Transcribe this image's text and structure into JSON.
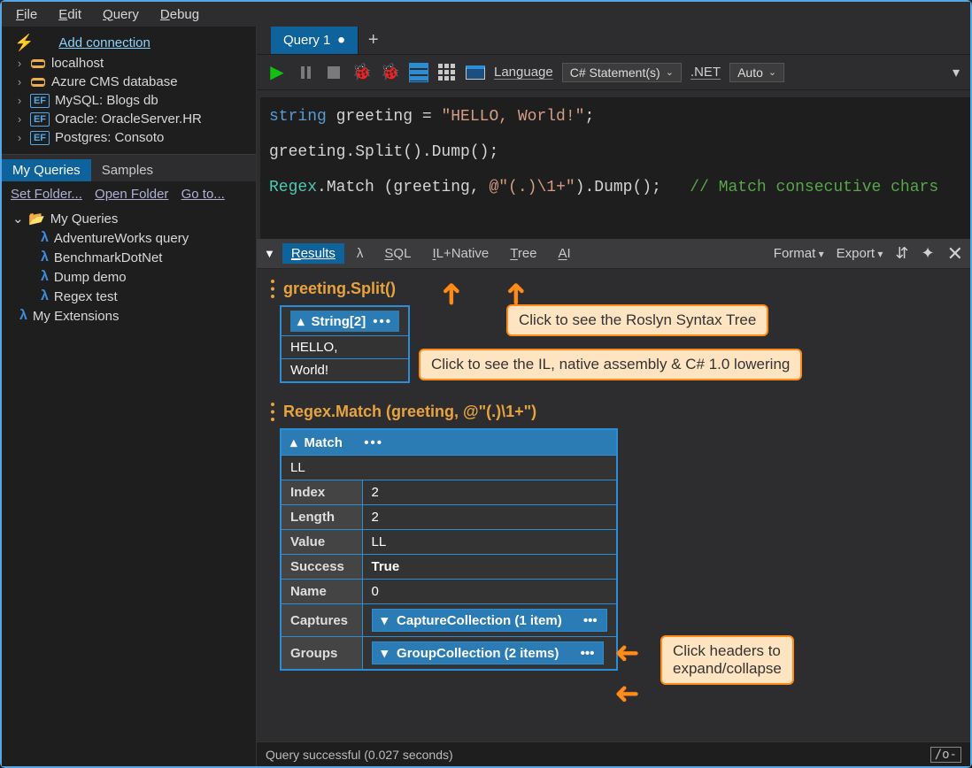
{
  "menu": [
    "File",
    "Edit",
    "Query",
    "Debug"
  ],
  "sidebar": {
    "add_connection": "Add connection",
    "connections": [
      {
        "icon": "db",
        "label": "localhost"
      },
      {
        "icon": "db",
        "label": "Azure CMS database"
      },
      {
        "icon": "ef",
        "label": "MySQL: Blogs db"
      },
      {
        "icon": "ef",
        "label": "Oracle: OracleServer.HR"
      },
      {
        "icon": "ef",
        "label": "Postgres: Consoto"
      }
    ],
    "queries_tabs": {
      "active": "My Queries",
      "inactive": "Samples"
    },
    "links": {
      "set": "Set Folder...",
      "open": "Open Folder",
      "goto": "Go to..."
    },
    "root": "My Queries",
    "items": [
      "AdventureWorks query",
      "BenchmarkDotNet",
      "Dump demo",
      "Regex test"
    ],
    "ext": "My Extensions"
  },
  "editor": {
    "tab_name": "Query 1",
    "toolbar": {
      "language_label": "Language",
      "language_value": "C# Statement(s)",
      "net_label": ".NET",
      "net_value": "Auto"
    },
    "code": {
      "l1a": "string",
      "l1b": " greeting = ",
      "l1c": "\"HELLO, World!\"",
      "l1d": ";",
      "l2": "greeting.Split().Dump();",
      "l3a": "Regex",
      "l3b": ".Match (greeting, ",
      "l3c": "@\"(.)\\1+\"",
      "l3d": ").Dump();",
      "l3e": "// Match consecutive chars"
    }
  },
  "results": {
    "tabs": [
      "Results",
      "λ",
      "SQL",
      "IL+Native",
      "Tree",
      "AI"
    ],
    "format": "Format",
    "export": "Export",
    "dump1_title": "greeting.Split()",
    "dump1_header": "String[2]",
    "dump1_rows": [
      "HELLO,",
      "World!"
    ],
    "dump2_title": "Regex.Match (greeting, @\"(.)\\1+\")",
    "dump2_header": "Match",
    "dump2_toprow": "LL",
    "dump2_rows": [
      {
        "k": "Index",
        "v": "2"
      },
      {
        "k": "Length",
        "v": "2"
      },
      {
        "k": "Value",
        "v": "LL"
      },
      {
        "k": "Success",
        "v": "True",
        "bold": true
      },
      {
        "k": "Name",
        "v": "0"
      }
    ],
    "captures_label": "Captures",
    "captures_pill": "CaptureCollection (1 item)",
    "groups_label": "Groups",
    "groups_pill": "GroupCollection (2 items)"
  },
  "callouts": {
    "tree": "Click to see the Roslyn Syntax Tree",
    "il": "Click to see the IL, native assembly & C# 1.0 lowering",
    "expand": "Click headers to\nexpand/collapse"
  },
  "status": {
    "msg": "Query successful (0.027 seconds)",
    "right": "/o-"
  }
}
